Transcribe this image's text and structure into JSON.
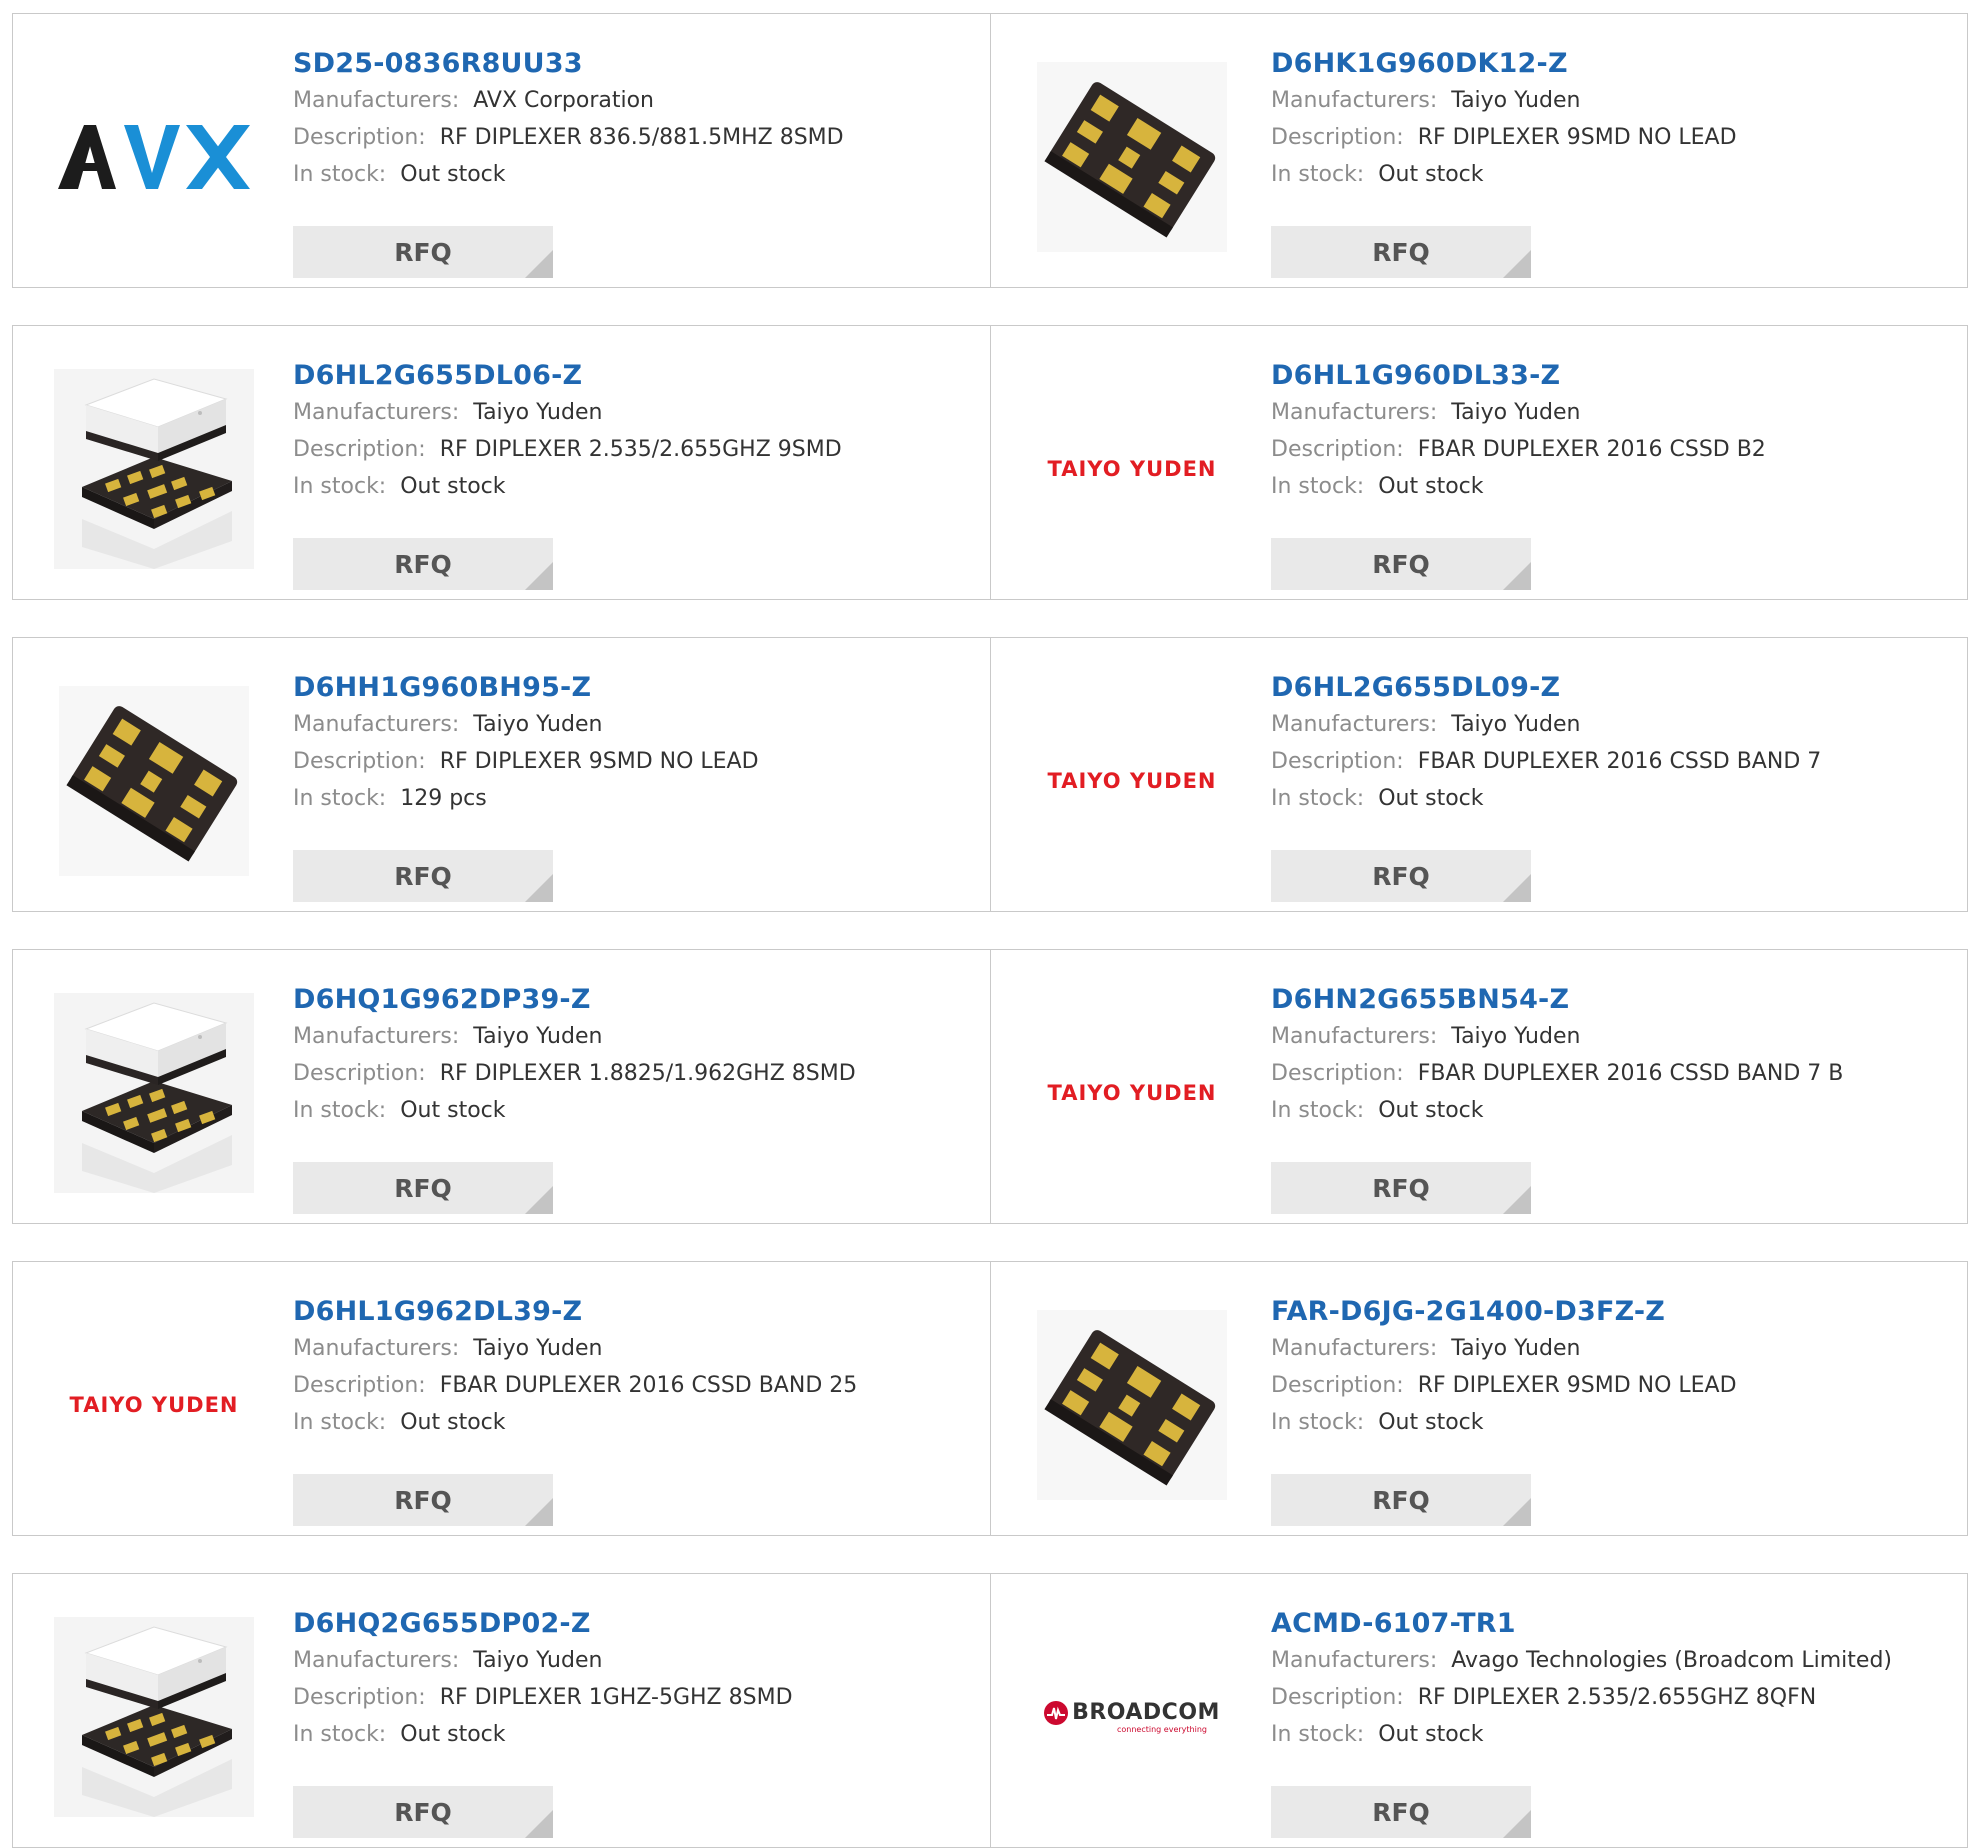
{
  "labels": {
    "manufacturers": "Manufacturers:",
    "description": "Description:",
    "in_stock": "In stock:",
    "rfq": "RFQ"
  },
  "logos": {
    "avx": "AVX",
    "taiyo": "TAIYO YUDEN",
    "broadcom": "BROADCOM",
    "broadcom_tagline": "connecting everything"
  },
  "colors": {
    "link": "#1f67b1",
    "label": "#8c8c8c",
    "text": "#333333",
    "button_bg": "#e9e9e9",
    "border": "#c9c9c9",
    "avx_blue": "#1a8fd6",
    "taiyo_red": "#e21d23",
    "broadcom_red": "#cc092f"
  },
  "products": [
    {
      "part": "SD25-0836R8UU33",
      "manufacturer": "AVX Corporation",
      "description": "RF DIPLEXER 836.5/881.5MHZ 8SMD",
      "stock": "Out stock",
      "image": "avx-logo"
    },
    {
      "part": "D6HK1G960DK12-Z",
      "manufacturer": "Taiyo Yuden",
      "description": "RF DIPLEXER 9SMD NO LEAD",
      "stock": "Out stock",
      "image": "chip-9pad"
    },
    {
      "part": "D6HL2G655DL06-Z",
      "manufacturer": "Taiyo Yuden",
      "description": "RF DIPLEXER 2.535/2.655GHZ 9SMD",
      "stock": "Out stock",
      "image": "chip-stacked"
    },
    {
      "part": "D6HL1G960DL33-Z",
      "manufacturer": "Taiyo Yuden",
      "description": "FBAR DUPLEXER 2016 CSSD B2",
      "stock": "Out stock",
      "image": "taiyo-logo"
    },
    {
      "part": "D6HH1G960BH95-Z",
      "manufacturer": "Taiyo Yuden",
      "description": "RF DIPLEXER 9SMD NO LEAD",
      "stock": "129 pcs",
      "image": "chip-9pad"
    },
    {
      "part": "D6HL2G655DL09-Z",
      "manufacturer": "Taiyo Yuden",
      "description": "FBAR DUPLEXER 2016 CSSD BAND 7",
      "stock": "Out stock",
      "image": "taiyo-logo"
    },
    {
      "part": "D6HQ1G962DP39-Z",
      "manufacturer": "Taiyo Yuden",
      "description": "RF DIPLEXER 1.8825/1.962GHZ 8SMD",
      "stock": "Out stock",
      "image": "chip-stacked"
    },
    {
      "part": "D6HN2G655BN54-Z",
      "manufacturer": "Taiyo Yuden",
      "description": "FBAR DUPLEXER 2016 CSSD BAND 7 B",
      "stock": "Out stock",
      "image": "taiyo-logo"
    },
    {
      "part": "D6HL1G962DL39-Z",
      "manufacturer": "Taiyo Yuden",
      "description": "FBAR DUPLEXER 2016 CSSD BAND 25",
      "stock": "Out stock",
      "image": "taiyo-logo"
    },
    {
      "part": "FAR-D6JG-2G1400-D3FZ-Z",
      "manufacturer": "Taiyo Yuden",
      "description": "RF DIPLEXER 9SMD NO LEAD",
      "stock": "Out stock",
      "image": "chip-9pad"
    },
    {
      "part": "D6HQ2G655DP02-Z",
      "manufacturer": "Taiyo Yuden",
      "description": "RF DIPLEXER 1GHZ-5GHZ 8SMD",
      "stock": "Out stock",
      "image": "chip-stacked"
    },
    {
      "part": "ACMD-6107-TR1",
      "manufacturer": "Avago Technologies (Broadcom Limited)",
      "description": "RF DIPLEXER 2.535/2.655GHZ 8QFN",
      "stock": "Out stock",
      "image": "broadcom-logo"
    }
  ]
}
